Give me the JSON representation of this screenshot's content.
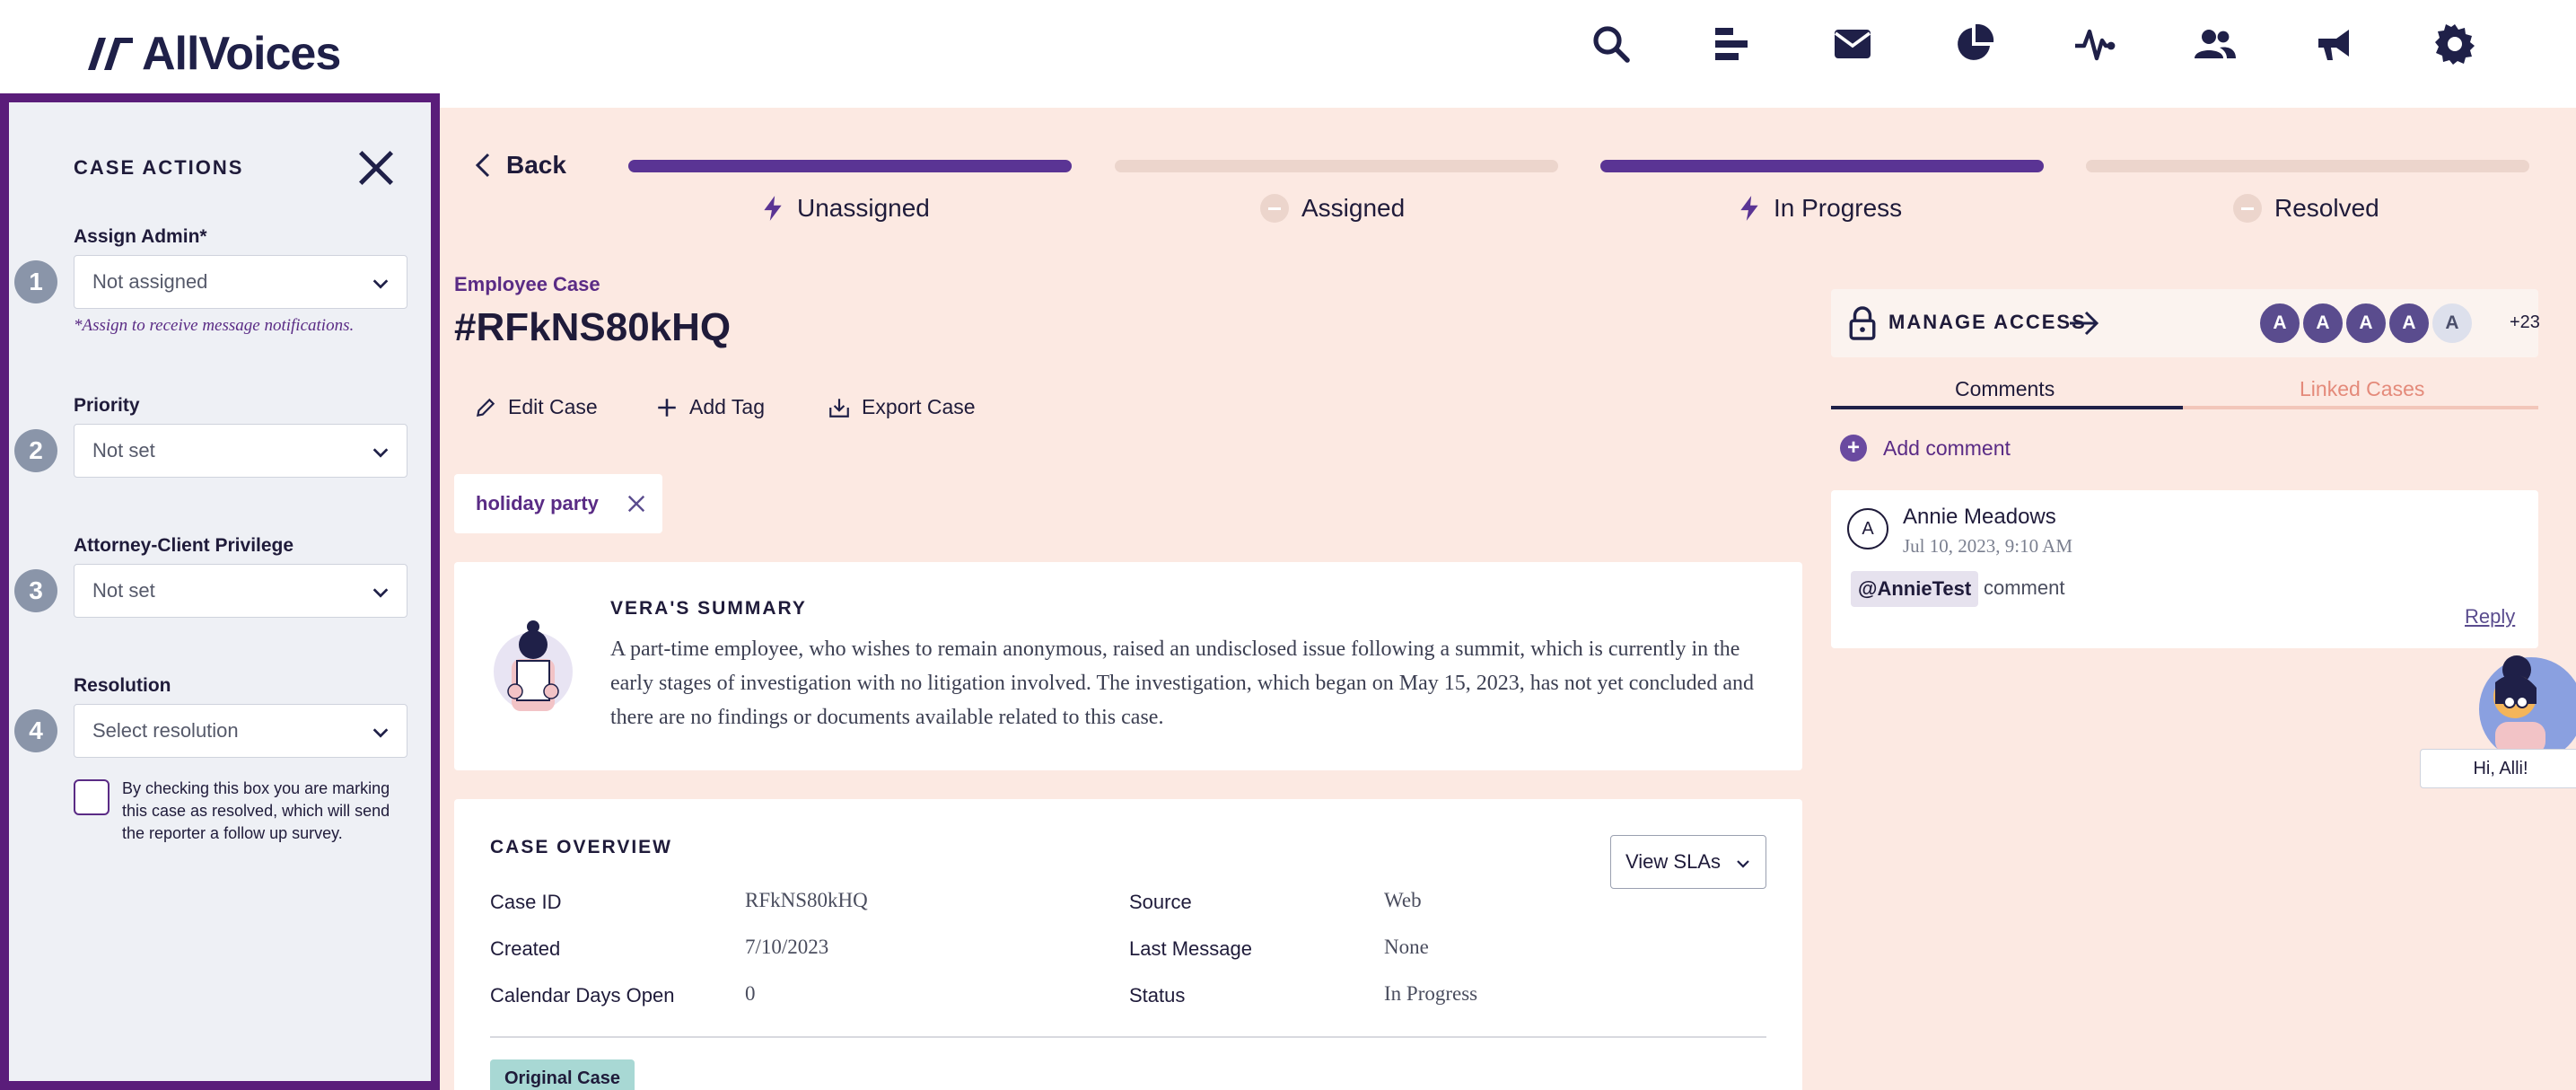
{
  "app": {
    "brand": "AllVoices"
  },
  "nav": {
    "icons": [
      "search-icon",
      "reports-icon",
      "mail-icon",
      "analytics-pie-icon",
      "activity-icon",
      "users-icon",
      "announcements-icon",
      "settings-gear-icon"
    ]
  },
  "sidebar": {
    "title": "CASE ACTIONS",
    "fields": [
      {
        "step": "1",
        "label": "Assign Admin*",
        "value": "Not assigned",
        "hint": "*Assign to receive message notifications."
      },
      {
        "step": "2",
        "label": "Priority",
        "value": "Not set"
      },
      {
        "step": "3",
        "label": "Attorney-Client Privilege",
        "value": "Not set"
      },
      {
        "step": "4",
        "label": "Resolution",
        "value": "Select resolution"
      }
    ],
    "resolve_checkbox_text": "By checking this box you are marking this case as resolved, which will send the reporter a follow up survey.",
    "resolve_checked": false
  },
  "progress": {
    "back_label": "Back",
    "stages": [
      {
        "label": "Unassigned",
        "active": true
      },
      {
        "label": "Assigned",
        "active": false
      },
      {
        "label": "In Progress",
        "active": true
      },
      {
        "label": "Resolved",
        "active": false
      }
    ]
  },
  "case": {
    "type": "Employee Case",
    "title": "#RFkNS80kHQ",
    "actions": {
      "edit": "Edit Case",
      "add_tag": "Add Tag",
      "export": "Export Case"
    },
    "tags": [
      "holiday party"
    ]
  },
  "summary": {
    "title": "VERA'S SUMMARY",
    "text": "A part-time employee, who wishes to remain anonymous, raised an undisclosed issue following a summit, which is currently in the early stages of investigation with no litigation involved. The investigation, which began on May 15, 2023, has not yet concluded and there are no findings or documents available related to this case."
  },
  "overview": {
    "title": "CASE OVERVIEW",
    "view_slas": "View SLAs",
    "left": [
      {
        "key": "Case ID",
        "value": "RFkNS80kHQ"
      },
      {
        "key": "Created",
        "value": "7/10/2023"
      },
      {
        "key": "Calendar Days Open",
        "value": "0"
      }
    ],
    "right": [
      {
        "key": "Source",
        "value": "Web"
      },
      {
        "key": "Last Message",
        "value": "None"
      },
      {
        "key": "Status",
        "value": "In Progress"
      }
    ],
    "badge": "Original Case"
  },
  "access": {
    "label": "MANAGE ACCESS",
    "avatars": [
      "A",
      "A",
      "A",
      "A",
      "A"
    ],
    "more": "+23"
  },
  "tabs": {
    "comments": "Comments",
    "linked": "Linked Cases"
  },
  "comments": {
    "add_label": "Add comment",
    "items": [
      {
        "initial": "A",
        "author": "Annie Meadows",
        "date": "Jul 10, 2023, 9:10 AM",
        "mention": "@AnnieTest",
        "text": "comment",
        "reply": "Reply"
      }
    ]
  },
  "assistant": {
    "greeting": "Hi, Alli!"
  },
  "colors": {
    "accent": "#5a3494",
    "sidebar_border": "#5a1d7a",
    "background": "#fce9e2"
  }
}
